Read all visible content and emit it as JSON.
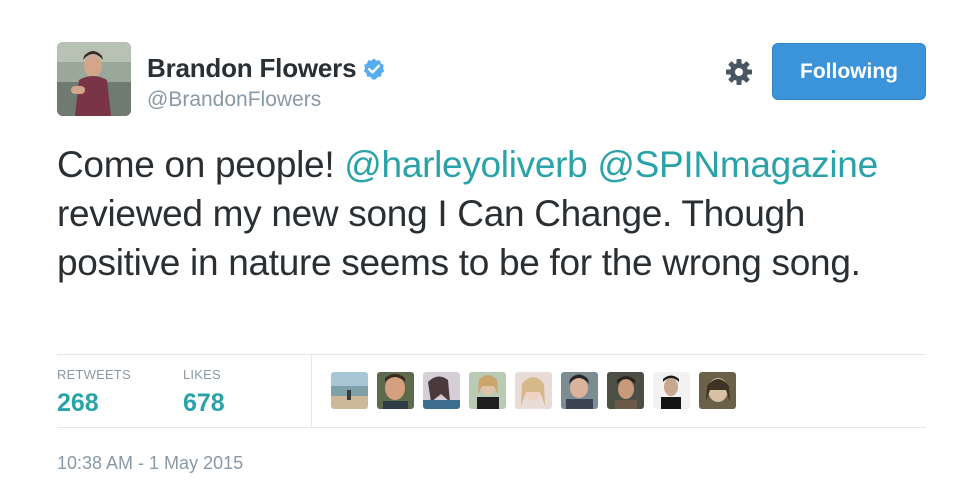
{
  "user": {
    "display_name": "Brandon Flowers",
    "handle": "@BrandonFlowers",
    "verified": true
  },
  "header": {
    "follow_label": "Following",
    "settings_icon": "gear-icon"
  },
  "tweet": {
    "segments": [
      {
        "type": "text",
        "value": "Come on people! "
      },
      {
        "type": "mention",
        "value": "@harleyoliverb"
      },
      {
        "type": "text",
        "value": " "
      },
      {
        "type": "mention",
        "value": "@SPINmagazine"
      },
      {
        "type": "text",
        "value": " reviewed my new song I Can Change.  Though positive in nature seems to be for the wrong song."
      }
    ]
  },
  "stats": {
    "retweets_label": "RETWEETS",
    "retweets_count": "268",
    "likes_label": "LIKES",
    "likes_count": "678"
  },
  "likers": [
    {
      "name": "liker-avatar"
    },
    {
      "name": "liker-avatar"
    },
    {
      "name": "liker-avatar"
    },
    {
      "name": "liker-avatar"
    },
    {
      "name": "liker-avatar"
    },
    {
      "name": "liker-avatar"
    },
    {
      "name": "liker-avatar"
    },
    {
      "name": "liker-avatar"
    },
    {
      "name": "liker-avatar"
    }
  ],
  "timestamp": "10:38 AM - 1 May 2015",
  "colors": {
    "accent": "#2aa3a8",
    "button": "#3b94d9",
    "muted": "#8899a6",
    "verified": "#55acee"
  }
}
